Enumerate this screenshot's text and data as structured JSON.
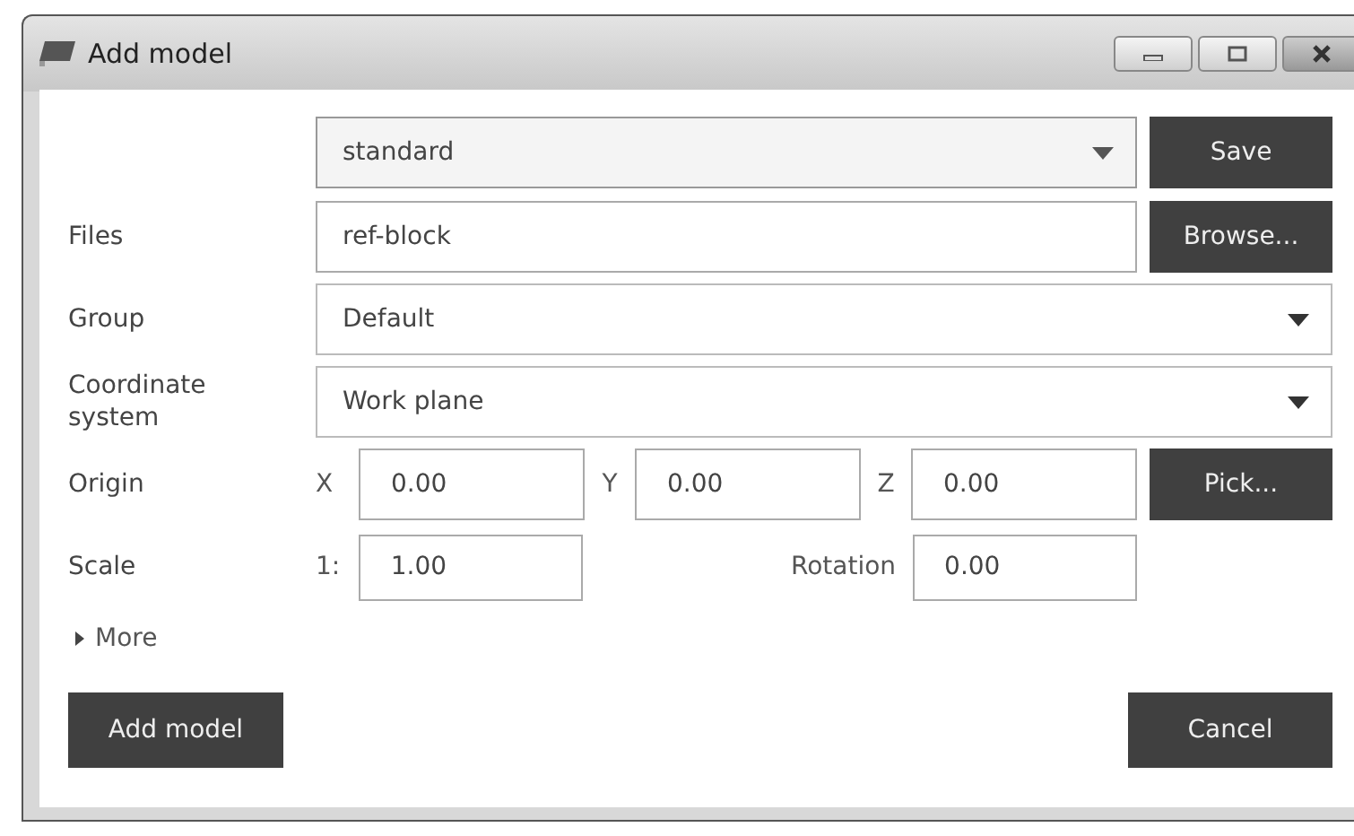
{
  "window": {
    "title": "Add model"
  },
  "profile": {
    "value": "standard",
    "button": "Save"
  },
  "files": {
    "label": "Files",
    "value": "ref-block",
    "button": "Browse..."
  },
  "group": {
    "label": "Group",
    "value": "Default"
  },
  "coordinate_system": {
    "label": "Coordinate system",
    "value": "Work plane"
  },
  "origin": {
    "label": "Origin",
    "fields": [
      {
        "axis": "X",
        "value": "0.00"
      },
      {
        "axis": "Y",
        "value": "0.00"
      },
      {
        "axis": "Z",
        "value": "0.00"
      }
    ],
    "button": "Pick..."
  },
  "scale": {
    "label": "Scale",
    "prefix": "1:",
    "value": "1.00",
    "rotation_label": "Rotation",
    "rotation_value": "0.00"
  },
  "more": {
    "label": "More",
    "expanded": false
  },
  "buttons": {
    "add": "Add model",
    "cancel": "Cancel"
  }
}
